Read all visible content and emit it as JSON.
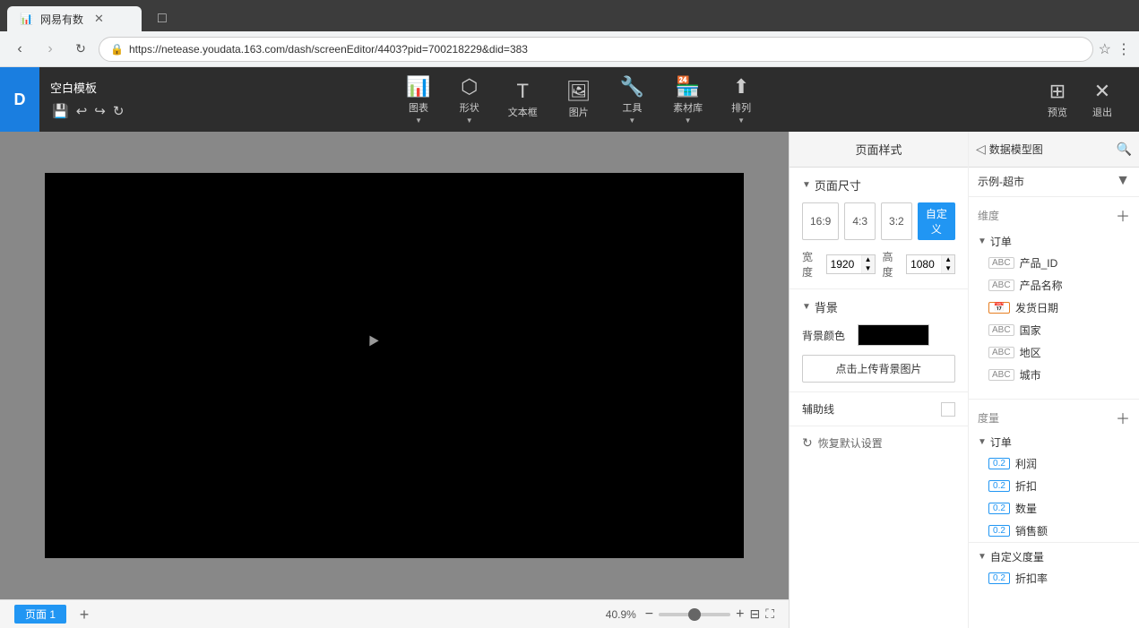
{
  "browser": {
    "tab_active": "网易有数",
    "tab_inactive": "",
    "url": "https://netease.youdata.163.com/dash/screenEditor/4403?pid=700218229&did=383",
    "lock_icon": "🔒"
  },
  "toolbar": {
    "template_name": "空白模板",
    "tools": {
      "save": "💾",
      "undo": "↩",
      "redo": "↪",
      "refresh": "↻"
    },
    "chart_label": "图表",
    "shape_label": "形状",
    "textbox_label": "文本框",
    "image_label": "图片",
    "tool_label": "工具",
    "assets_label": "素材库",
    "arrange_label": "排列",
    "preview_label": "预览",
    "exit_label": "退出"
  },
  "right_panel": {
    "page_style_tab": "页面样式",
    "data_model_tab": "数据模型图",
    "search_placeholder": "搜索",
    "page_size": {
      "title": "页面尺寸",
      "btn_16_9": "16:9",
      "btn_4_3": "4:3",
      "btn_3_2": "3:2",
      "btn_custom": "自定义",
      "width_label": "宽度",
      "width_value": "1920",
      "height_label": "高度",
      "height_value": "1080"
    },
    "background": {
      "title": "背景",
      "color_label": "背景颜色",
      "upload_btn": "点击上传背景图片"
    },
    "gridline": {
      "label": "辅助线"
    },
    "reset_btn": "恢复默认设置"
  },
  "data_panel": {
    "dataset_name": "示例-超市",
    "dimensions": {
      "title": "维度",
      "group_order": "订单",
      "items": [
        {
          "type": "ABC",
          "label": "产品_ID",
          "type_class": "abc"
        },
        {
          "type": "ABC",
          "label": "产品名称",
          "type_class": "abc"
        },
        {
          "type": "DATE",
          "label": "发货日期",
          "type_class": "date"
        },
        {
          "type": "ABC",
          "label": "国家",
          "type_class": "abc"
        },
        {
          "type": "ABC",
          "label": "地区",
          "type_class": "abc"
        },
        {
          "type": "ABC",
          "label": "城市",
          "type_class": "abc"
        }
      ]
    },
    "measures": {
      "title": "度量",
      "group_order": "订单",
      "items": [
        {
          "type": "0.2",
          "label": "利润"
        },
        {
          "type": "0.2",
          "label": "折扣"
        },
        {
          "type": "0.2",
          "label": "数量"
        },
        {
          "type": "0.2",
          "label": "销售额"
        }
      ],
      "custom_title": "自定义度量",
      "custom_items": [
        {
          "type": "0.2",
          "label": "折扣率"
        }
      ]
    }
  },
  "canvas": {
    "background_color": "#000000"
  },
  "bottom_bar": {
    "page_label": "页面 1",
    "add_page": "+",
    "zoom_percent": "40.9%",
    "zoom_minus": "−",
    "zoom_plus": "+",
    "fit_icon": "⊡",
    "fullscreen_icon": "⛶"
  }
}
